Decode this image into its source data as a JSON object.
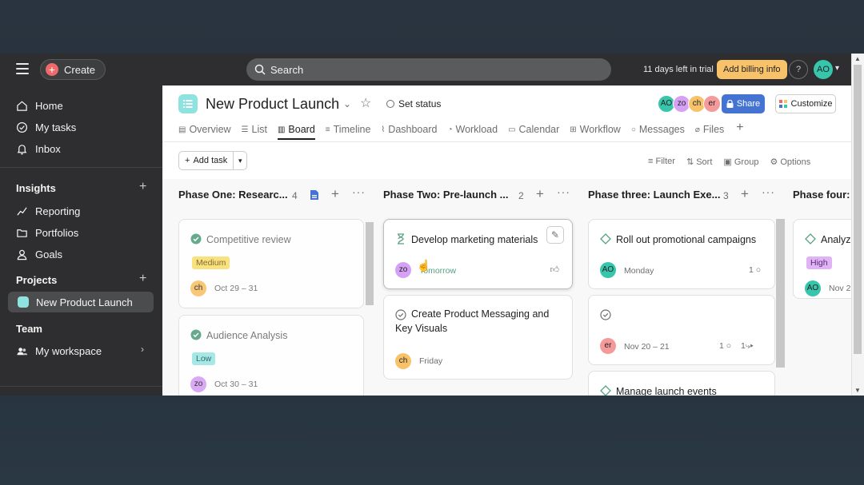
{
  "topbar": {
    "create_label": "Create",
    "search_placeholder": "Search",
    "trial_text": "11 days left in trial",
    "billing_label": "Add billing info",
    "help_label": "?",
    "user_initials": "AO"
  },
  "sidebar": {
    "nav": [
      {
        "label": "Home",
        "icon": "home-icon"
      },
      {
        "label": "My tasks",
        "icon": "check-circle-icon"
      },
      {
        "label": "Inbox",
        "icon": "bell-icon"
      }
    ],
    "insights": {
      "title": "Insights",
      "items": [
        {
          "label": "Reporting",
          "icon": "reporting-icon"
        },
        {
          "label": "Portfolios",
          "icon": "folder-icon"
        },
        {
          "label": "Goals",
          "icon": "person-icon"
        }
      ]
    },
    "projects": {
      "title": "Projects",
      "items": [
        {
          "label": "New Product Launch",
          "color": "#8ee3e0"
        }
      ]
    },
    "team": {
      "title": "Team",
      "items": [
        {
          "label": "My workspace",
          "icon": "people-icon"
        }
      ]
    }
  },
  "project": {
    "title": "New Product Launch",
    "set_status": "Set status",
    "members": [
      {
        "initials": "AO",
        "color": "#37c5ab"
      },
      {
        "initials": "zo",
        "color": "#d6a1f5"
      },
      {
        "initials": "ch",
        "color": "#f8c26b"
      },
      {
        "initials": "er",
        "color": "#f59a9a"
      }
    ],
    "share_label": "Share",
    "customize_label": "Customize",
    "tabs": [
      {
        "label": "Overview",
        "icon": "overview-icon",
        "active": false
      },
      {
        "label": "List",
        "icon": "list-icon",
        "active": false
      },
      {
        "label": "Board",
        "icon": "board-icon",
        "active": true
      },
      {
        "label": "Timeline",
        "icon": "timeline-icon",
        "active": false
      },
      {
        "label": "Dashboard",
        "icon": "dashboard-icon",
        "active": false
      },
      {
        "label": "Workload",
        "icon": "workload-icon",
        "active": false
      },
      {
        "label": "Calendar",
        "icon": "calendar-icon",
        "active": false
      },
      {
        "label": "Workflow",
        "icon": "workflow-icon",
        "active": false
      },
      {
        "label": "Messages",
        "icon": "message-icon",
        "active": false
      },
      {
        "label": "Files",
        "icon": "paperclip-icon",
        "active": false
      }
    ]
  },
  "toolbar": {
    "add_task": "Add task",
    "filter": "Filter",
    "sort": "Sort",
    "group": "Group",
    "options": "Options"
  },
  "columns": [
    {
      "title": "Phase One: Researc...",
      "count": "4",
      "cards": [
        {
          "title": "Competitive review",
          "status": "done",
          "tag": "Medium",
          "tag_color": "#f8df72",
          "assignee": "ch",
          "assignee_color": "#f8c26b",
          "date": "Oct 29 – 31"
        },
        {
          "title": "Audience Analysis",
          "status": "done",
          "tag": "Low",
          "tag_color": "#9ee7e3",
          "assignee": "zo",
          "assignee_color": "#d6a1f5",
          "date": "Oct 30 – 31"
        }
      ]
    },
    {
      "title": "Phase Two: Pre-launch ...",
      "count": "2",
      "cards": [
        {
          "title": "Develop marketing materials",
          "status": "in-progress",
          "assignee": "zo",
          "assignee_color": "#d6a1f5",
          "date": "Tomorrow"
        },
        {
          "title": "Create Product Messaging and Key Visuals",
          "status": "open",
          "assignee": "ch",
          "assignee_color": "#f8c26b",
          "date": "Friday"
        }
      ]
    },
    {
      "title": "Phase three: Launch Exe...",
      "count": "3",
      "cards": [
        {
          "title": "Roll out promotional campaigns",
          "status": "milestone",
          "assignee": "AO",
          "assignee_color": "#37c5ab",
          "date": "Monday",
          "comments": "1"
        },
        {
          "title": "",
          "status": "open",
          "assignee": "er",
          "assignee_color": "#f59a9a",
          "date": "Nov 20 – 21",
          "comments": "1",
          "subtasks": "1"
        },
        {
          "title": "Manage launch events",
          "status": "milestone"
        }
      ]
    },
    {
      "title": "Phase four:",
      "cards": [
        {
          "title": "Analyze",
          "status": "milestone",
          "tag": "High",
          "tag_color": "#e0b3f5",
          "assignee": "AO",
          "assignee_color": "#37c5ab",
          "date": "Nov 2"
        }
      ]
    }
  ]
}
